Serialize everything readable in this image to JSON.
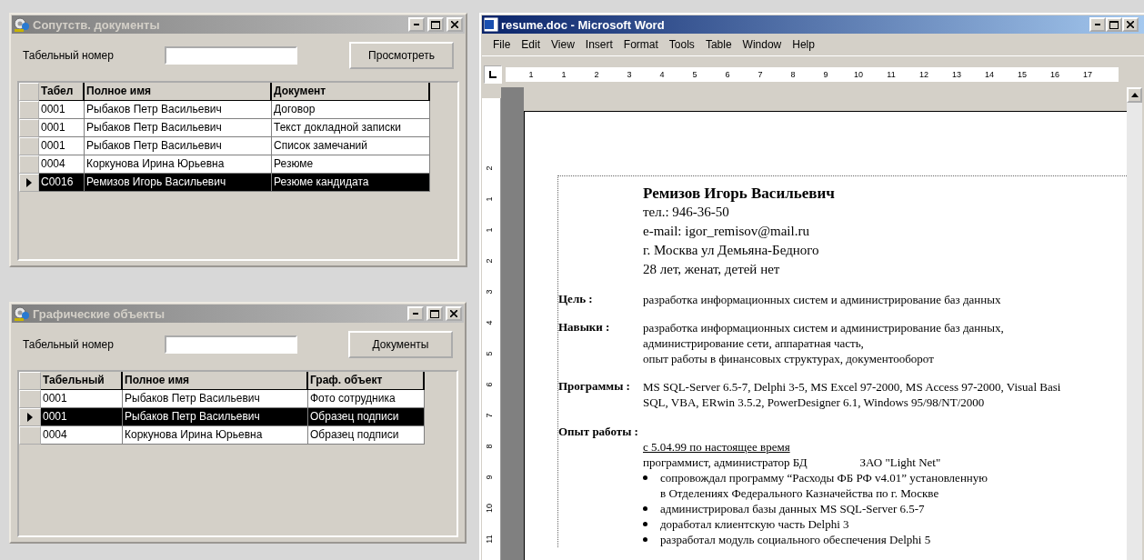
{
  "forms": [
    {
      "title": "Сопутств. документы",
      "active": false,
      "field_label": "Табельный номер",
      "button": "Просмотреть",
      "columns": [
        "Табел",
        "Полное имя",
        "Документ"
      ],
      "rows": [
        {
          "cells": [
            "0001",
            "Рыбаков Петр Васильевич",
            "Договор"
          ],
          "selected": false
        },
        {
          "cells": [
            "0001",
            "Рыбаков Петр Васильевич",
            "Текст докладной записки"
          ],
          "selected": false
        },
        {
          "cells": [
            "0001",
            "Рыбаков Петр Васильевич",
            "Список замечаний"
          ],
          "selected": false
        },
        {
          "cells": [
            "0004",
            "Коркунова Ирина Юрьевна",
            "Резюме"
          ],
          "selected": false
        },
        {
          "cells": [
            "C0016",
            "Ремизов Игорь Васильевич",
            "Резюме кандидата"
          ],
          "selected": true
        }
      ]
    },
    {
      "title": "Графические объекты",
      "active": false,
      "field_label": "Табельный номер",
      "button": "Документы",
      "columns": [
        "Табельный",
        "Полное имя",
        "Граф. объект"
      ],
      "rows": [
        {
          "cells": [
            "0001",
            "Рыбаков Петр Васильевич",
            "Фото сотрудника"
          ],
          "selected": false
        },
        {
          "cells": [
            "0001",
            "Рыбаков Петр Васильевич",
            "Образец подписи"
          ],
          "selected": true
        },
        {
          "cells": [
            "0004",
            "Коркунова Ирина Юрьевна",
            "Образец подписи"
          ],
          "selected": false
        }
      ]
    }
  ],
  "word": {
    "title": "resume.doc - Microsoft Word",
    "active": true,
    "menu": [
      "File",
      "Edit",
      "View",
      "Insert",
      "Format",
      "Tools",
      "Table",
      "Window",
      "Help"
    ],
    "ruler_h": [
      "1",
      "1",
      "2",
      "3",
      "4",
      "5",
      "6",
      "7",
      "8",
      "9",
      "10",
      "11",
      "12",
      "13",
      "14",
      "15",
      "16",
      "17"
    ],
    "ruler_v": [
      "2",
      "1",
      "1",
      "2",
      "3",
      "4",
      "5",
      "6",
      "7",
      "8",
      "9",
      "10",
      "11"
    ],
    "header": [
      {
        "kind": "name",
        "text": "Ремизов  Игорь  Васильевич"
      },
      {
        "kind": "line",
        "text": "тел.: 946-36-50"
      },
      {
        "kind": "line",
        "text": "e-mail: igor_remisov@mail.ru"
      },
      {
        "kind": "line",
        "text": "г. Москва ул Демьяна-Бедного"
      },
      {
        "kind": "line",
        "text": "28 лет,  женат,  детей нет"
      }
    ],
    "sections": [
      {
        "label": "Цель :",
        "items": [
          {
            "kind": "text",
            "text": "разработка информационных систем и администрирование баз данных"
          }
        ]
      },
      {
        "label": "Навыки :",
        "items": [
          {
            "kind": "text",
            "text": "разработка информационных систем и администрирование баз данных,"
          },
          {
            "kind": "text",
            "text": "администрирование сети, аппаратная часть,"
          },
          {
            "kind": "text",
            "text": "опыт работы в финансовых структурах, документооборот"
          }
        ]
      },
      {
        "label": "Программы :",
        "items": [
          {
            "kind": "text",
            "text": "MS SQL-Server 6.5-7, Delphi 3-5, MS Excel 97-2000, MS Access 97-2000, Visual Basi"
          },
          {
            "kind": "text",
            "text": "SQL, VBA, ERwin 3.5.2, PowerDesigner 6.1, Windows 95/98/NT/2000"
          }
        ]
      },
      {
        "label": "Опыт работы :",
        "items": [
          {
            "kind": "period",
            "text": "с 5.04.99 по настоящее время"
          },
          {
            "kind": "job",
            "text": "программист, администратор БД",
            "company": "ЗАО \"Light Net\""
          },
          {
            "kind": "bullet",
            "lines": [
              "сопровождал программу “Расходы ФБ РФ v4.01” установленную",
              "в Отделениях Федерального Казначейства по г. Москве"
            ]
          },
          {
            "kind": "bullet",
            "lines": [
              "администрировал базы данных MS SQL-Server 6.5-7"
            ]
          },
          {
            "kind": "bullet",
            "lines": [
              "доработал клиентскую часть Delphi 3"
            ]
          },
          {
            "kind": "bullet",
            "lines": [
              "разработал модуль социального обеспечения Delphi 5"
            ]
          }
        ]
      }
    ]
  }
}
